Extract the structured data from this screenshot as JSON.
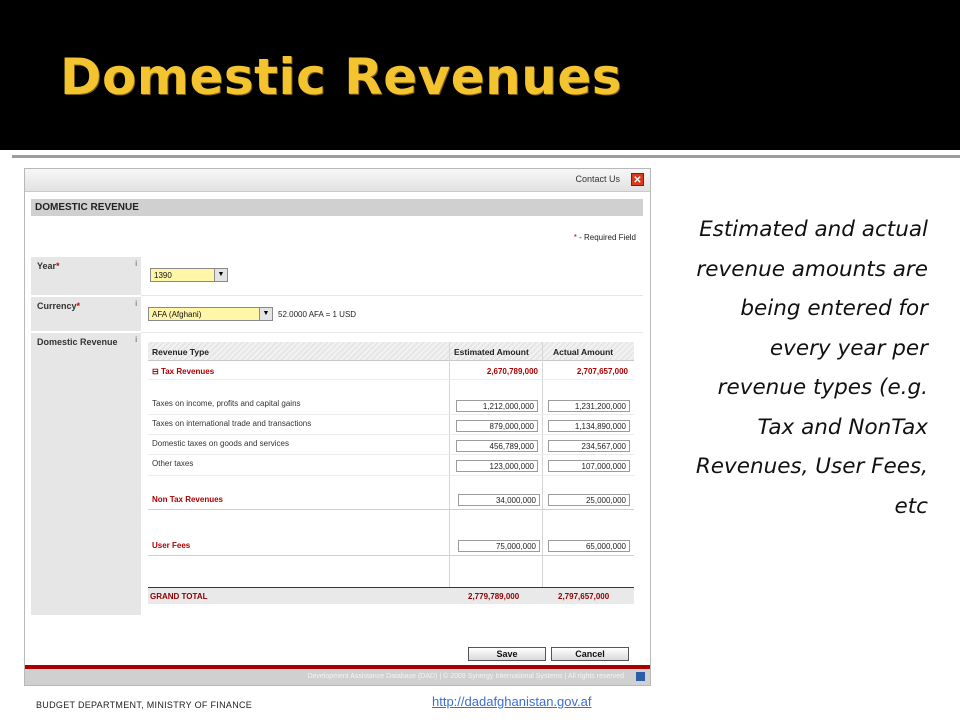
{
  "slide": {
    "title": "Domestic Revenues",
    "description": "Estimated and actual revenue amounts are being entered for every year per revenue types (e.g. Tax and NonTax Revenues, User Fees, etc",
    "footer_left": "BUDGET DEPARTMENT, MINISTRY OF FINANCE",
    "footer_link": "http://dadafghanistan.gov.af",
    "colors": {
      "title": "#f4c430",
      "background_top": "#000000",
      "accent_red": "#b00000"
    }
  },
  "app": {
    "topbar": {
      "contact_label": "Contact Us",
      "close_icon": "close-icon"
    },
    "section_title": "DOMESTIC REVENUE",
    "required_note": "- Required Field",
    "required_star": "*",
    "fields": {
      "year": {
        "label": "Year",
        "star": "*",
        "info": "i",
        "value": "1390"
      },
      "currency": {
        "label": "Currency",
        "star": "*",
        "info": "i",
        "value": "AFA (Afghani)",
        "rate": "52.0000 AFA = 1 USD"
      },
      "domestic_revenue": {
        "label": "Domestic Revenue",
        "info": "i"
      }
    },
    "table": {
      "headers": {
        "type": "Revenue Type",
        "estimated": "Estimated Amount",
        "actual": "Actual Amount"
      },
      "tax": {
        "toggle": "⊟",
        "label": "Tax Revenues",
        "estimated": "2,670,789,000",
        "actual": "2,707,657,000",
        "rows": [
          {
            "label": "Taxes on income, profits and capital gains",
            "estimated": "1,212,000,000",
            "actual": "1,231,200,000"
          },
          {
            "label": "Taxes on international trade and transactions",
            "estimated": "879,000,000",
            "actual": "1,134,890,000"
          },
          {
            "label": "Domestic taxes on goods and services",
            "estimated": "456,789,000",
            "actual": "234,567,000"
          },
          {
            "label": "Other taxes",
            "estimated": "123,000,000",
            "actual": "107,000,000"
          }
        ]
      },
      "non_tax": {
        "label": "Non Tax Revenues",
        "estimated": "34,000,000",
        "actual": "25,000,000"
      },
      "user_fees": {
        "label": "User Fees",
        "estimated": "75,000,000",
        "actual": "65,000,000"
      },
      "grand_total": {
        "label": "GRAND TOTAL",
        "estimated": "2,779,789,000",
        "actual": "2,797,657,000"
      }
    },
    "buttons": {
      "save": "Save",
      "cancel": "Cancel"
    },
    "footer": "Development Assistance Database (DAD) | © 2009 Synergy International Systems | All rights reserved"
  }
}
